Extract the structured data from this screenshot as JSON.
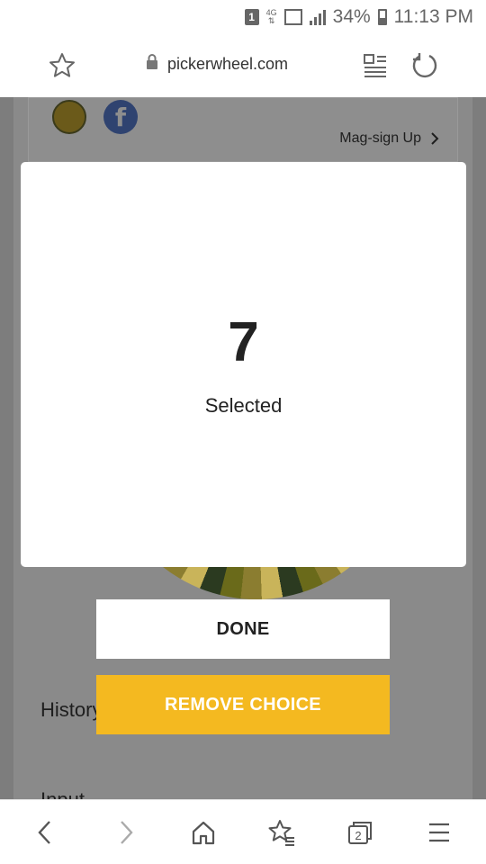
{
  "status_bar": {
    "sim_slot": "1",
    "network": "4G",
    "battery": "34%",
    "time": "11:13 PM"
  },
  "toolbar": {
    "url": "pickerwheel.com",
    "icons": [
      "star-icon",
      "lock-icon",
      "reader-mode-icon",
      "reload-icon"
    ]
  },
  "page": {
    "signup_label": "Mag-sign Up",
    "history_label": "History",
    "input_label": "Input"
  },
  "modal": {
    "result": "7",
    "result_label": "Selected"
  },
  "buttons": {
    "done": "DONE",
    "remove_choice": "REMOVE CHOICE"
  },
  "bottom_nav": {
    "tab_count": "2",
    "icons": [
      "back-icon",
      "forward-icon",
      "home-icon",
      "bookmarks-icon",
      "tabs-icon",
      "menu-icon"
    ]
  },
  "colors": {
    "accent": "#f4b920",
    "overlay": "#7d7d7d"
  }
}
